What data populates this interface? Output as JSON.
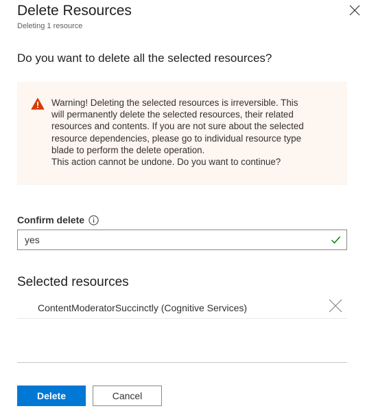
{
  "panel": {
    "title": "Delete Resources",
    "subtitle": "Deleting 1 resource"
  },
  "question": "Do you want to delete all the selected resources?",
  "warning": {
    "icon": "warning-triangle-icon",
    "lines": [
      "Warning! Deleting the selected resources is irreversible. This",
      "will permanently delete the selected resources, their related",
      "resources and contents. If you are not sure about the selected",
      "resource dependencies, please go to individual resource type",
      "blade to perform the delete operation.",
      "This action cannot be undone. Do you want to continue?"
    ]
  },
  "confirm": {
    "label": "Confirm delete",
    "value": "yes",
    "info_icon": "info-icon",
    "valid_icon": "checkmark-icon"
  },
  "selected_resources": {
    "title": "Selected resources",
    "items": [
      {
        "label": "ContentModeratorSuccinctly  (Cognitive Services)"
      }
    ]
  },
  "buttons": {
    "delete_label": "Delete",
    "cancel_label": "Cancel"
  },
  "colors": {
    "primary": "#0078d4",
    "warning_bg": "#fdf6f1",
    "warning_icon": "#d83b01",
    "valid": "#107c10"
  }
}
